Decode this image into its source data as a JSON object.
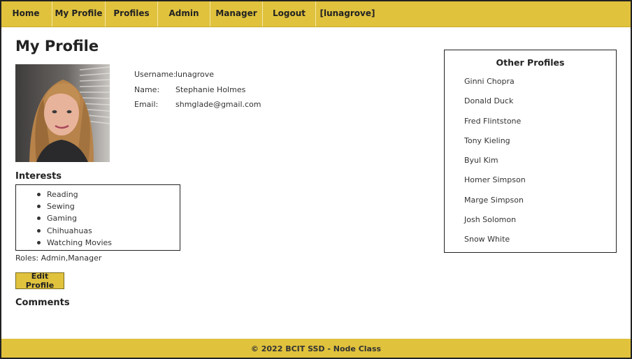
{
  "nav": {
    "items": [
      {
        "label": "Home"
      },
      {
        "label": "My Profile"
      },
      {
        "label": "Profiles"
      },
      {
        "label": "Admin"
      },
      {
        "label": "Manager"
      },
      {
        "label": "Logout"
      },
      {
        "label": "[lunagrove]"
      }
    ]
  },
  "page": {
    "title": "My Profile"
  },
  "profile": {
    "username_label": "Username:",
    "username": "lunagrove",
    "name_label": "Name:",
    "name": "Stephanie Holmes",
    "email_label": "Email:",
    "email": "shmglade@gmail.com"
  },
  "interests": {
    "heading": "Interests",
    "items": [
      "Reading",
      "Sewing",
      "Gaming",
      "Chihuahuas",
      "Watching Movies"
    ]
  },
  "roles": {
    "label": "Roles: ",
    "value": "Admin,Manager"
  },
  "actions": {
    "edit_label": "Edit Profile"
  },
  "comments": {
    "heading": "Comments"
  },
  "other_profiles": {
    "title": "Other Profiles",
    "items": [
      "Ginni Chopra",
      "Donald Duck",
      "Fred Flintstone",
      "Tony Kieling",
      "Byul Kim",
      "Homer Simpson",
      "Marge Simpson",
      "Josh Solomon",
      "Snow White"
    ]
  },
  "footer": {
    "text": "© 2022 BCIT SSD - Node Class"
  },
  "colors": {
    "accent": "#e0c23d",
    "text": "#222222"
  }
}
